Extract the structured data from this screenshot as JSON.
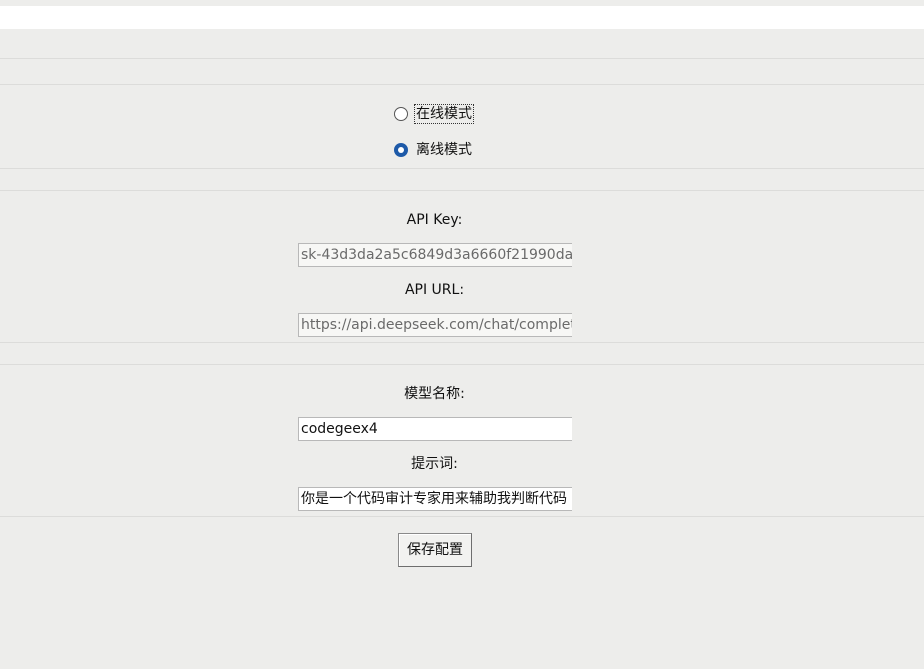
{
  "mode": {
    "options": [
      {
        "label": "在线模式",
        "selected": false
      },
      {
        "label": "离线模式",
        "selected": true
      }
    ]
  },
  "api": {
    "key_label": "API Key:",
    "key_value": "sk-43d3da2a5c6849d3a6660f21990da",
    "url_label": "API URL:",
    "url_value": "https://api.deepseek.com/chat/completions"
  },
  "model": {
    "name_label": "模型名称:",
    "name_value": "codegeex4",
    "prompt_label": "提示词:",
    "prompt_value": "你是一个代码审计专家用来辅助我判断代码"
  },
  "actions": {
    "save_label": "保存配置"
  },
  "colors": {
    "background": "#ededeb",
    "accent": "#1e5aa8"
  }
}
